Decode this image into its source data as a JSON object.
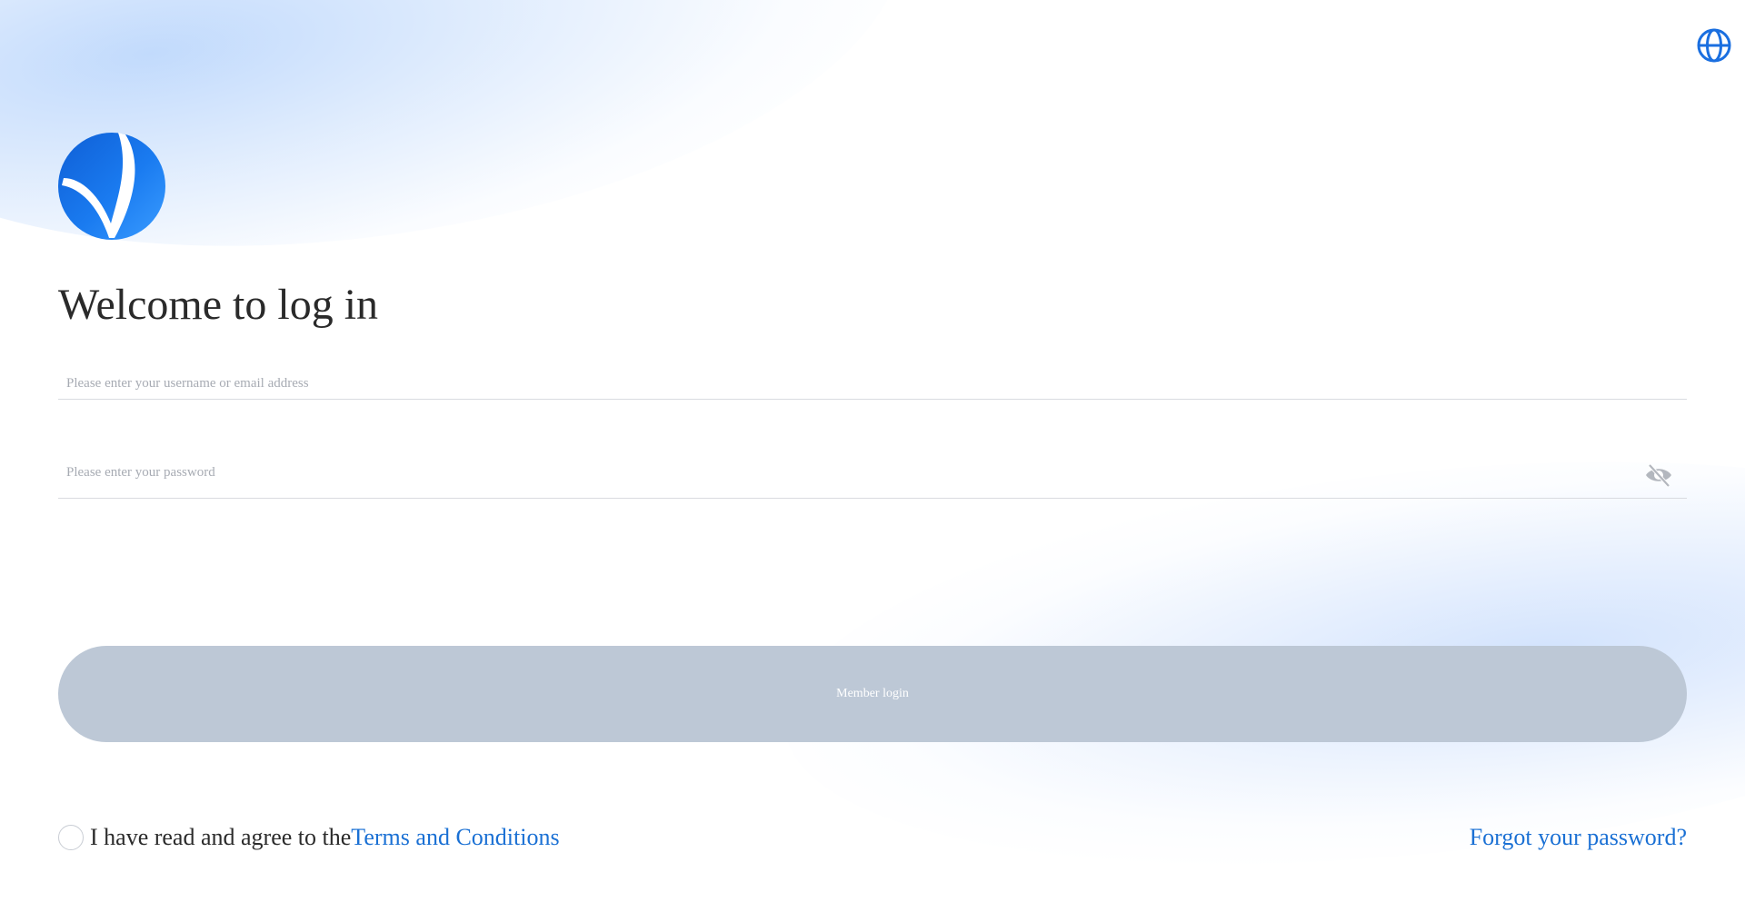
{
  "header": {
    "language_icon": "globe-icon"
  },
  "brand": {
    "logo_icon": "v-logo-icon",
    "logo_color": "#1a7bf0"
  },
  "login": {
    "title": "Welcome to log in",
    "username_placeholder": "Please enter your username or email address",
    "username_value": "",
    "password_placeholder": "Please enter your password",
    "password_value": "",
    "password_toggle_icon": "eye-off-icon",
    "submit_label": "Member login",
    "submit_color": "#bdc8d6"
  },
  "footer": {
    "agree_text": "I have read and agree to the",
    "terms_label": "Terms and Conditions",
    "forgot_label": "Forgot your password?",
    "link_color": "#1a70d4"
  }
}
